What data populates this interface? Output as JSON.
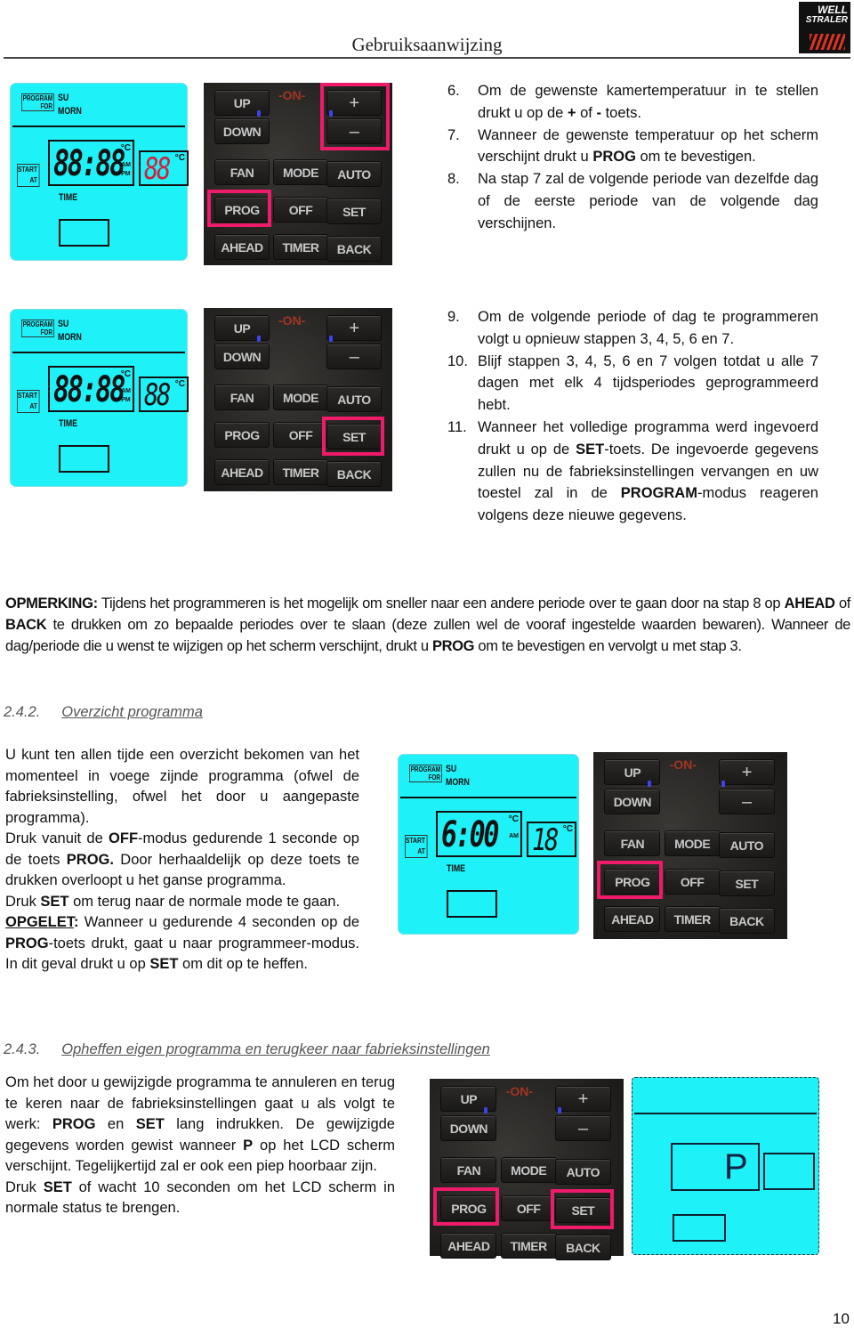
{
  "header": {
    "title": "Gebruiksaanwijzing",
    "logo_line1": "WELL",
    "logo_line2": "STRALER"
  },
  "lcd_labels": {
    "program": "PROGRAM",
    "for": "FOR",
    "day": "SU",
    "period": "MORN",
    "start": "START",
    "at": "AT",
    "time": "TIME",
    "am": "AM",
    "pm": "PM",
    "deg": "°C"
  },
  "remote_keys": {
    "up": "UP",
    "down": "DOWN",
    "on": "-ON-",
    "plus": "+",
    "minus": "–",
    "fan": "FAN",
    "mode": "MODE",
    "auto": "AUTO",
    "prog": "PROG",
    "off": "OFF",
    "set": "SET",
    "ahead": "AHEAD",
    "timer": "TIMER",
    "back": "BACK"
  },
  "figures": {
    "fig1": {
      "time_digits": "88:88",
      "temp_digits": "88",
      "temp_color": "#d0213a",
      "highlighted": [
        "plus-minus",
        "PROG"
      ]
    },
    "fig2": {
      "time_digits": "88:88",
      "temp_digits": "88",
      "temp_color": "#111111",
      "highlighted": [
        "SET"
      ]
    },
    "fig3": {
      "time_digits": "6:00",
      "temp_digits": "18",
      "temp_color": "#111111",
      "show_pm": false,
      "highlighted": [
        "PROG"
      ]
    },
    "fig4": {
      "lcd_symbol": "P",
      "highlighted": [
        "PROG",
        "SET"
      ]
    }
  },
  "steps_a": [
    {
      "num": "6.",
      "html": "Om de gewenste kamertemperatuur in te stellen drukt u op de <b>+</b> of <b>-</b> toets."
    },
    {
      "num": "7.",
      "html": "Wanneer de gewenste temperatuur op het scherm verschijnt drukt u <b>PROG</b> om te bevestigen."
    },
    {
      "num": "8.",
      "html": "Na stap 7 zal de volgende periode van dezelfde dag of de eerste periode van de volgende dag verschijnen."
    }
  ],
  "steps_b": [
    {
      "num": "9.",
      "html": "Om de volgende periode of dag te programmeren volgt u opnieuw stappen 3, 4, 5, 6 en 7."
    },
    {
      "num": "10.",
      "html": "Blijf stappen 3, 4, 5, 6 en 7 volgen totdat u alle 7 dagen met elk 4 tijdsperiodes geprogrammeerd hebt."
    },
    {
      "num": "11.",
      "html": "Wanneer het volledige programma werd ingevoerd drukt u op de <b>SET</b>-toets. De ingevoerde gegevens zullen nu de fabrieksinstellingen vervangen en uw toestel zal in de <b>PROGRAM</b>-modus reageren volgens deze nieuwe gegevens."
    }
  ],
  "note": {
    "label": "OPMERKING:",
    "html": " Tijdens het programmeren is het mogelijk om sneller naar een andere periode over te gaan door na stap 8 op <b>AHEAD</b> of <b>BACK</b> te drukken om zo bepaalde periodes over te slaan (deze zullen wel de vooraf ingestelde waarden bewaren). Wanneer de dag/periode die u wenst te wijzigen op het scherm verschijnt, drukt u <b>PROG</b> om te bevestigen en vervolgt u met stap 3."
  },
  "section_242": {
    "number": "2.4.2.",
    "title": "Overzicht programma",
    "paragraphs": [
      "U kunt ten allen tijde een overzicht bekomen van het momenteel in voege zijnde programma (ofwel de fabrieksinstelling, ofwel het door u aangepaste programma).",
      "Druk vanuit de <b>OFF</b>-modus gedurende 1 seconde op de toets <b>PROG.</b> Door herhaaldelijk op deze toets te drukken overloopt u het ganse programma.",
      "Druk <b>SET</b> om terug naar de normale mode te gaan.",
      "<b><u>OPGELET</u>:</b> Wanneer u gedurende 4 seconden op de <b>PROG</b>-toets drukt, gaat u naar programmeer-modus. In dit geval drukt u op <b>SET</b> om dit op te heffen."
    ]
  },
  "section_243": {
    "number": "2.4.3.",
    "title": "Opheffen eigen programma en terugkeer naar fabrieksinstellingen",
    "paragraphs": [
      "Om het door u gewijzigde programma te annuleren en terug te keren naar de fabrieksinstellingen gaat u als volgt te werk: <b>PROG</b> en <b>SET</b> lang indrukken. De gewijzigde gegevens worden gewist wanneer <b>P</b> op het LCD scherm verschijnt. Tegelijkertijd zal er ook een piep hoorbaar zijn.",
      "Druk <b>SET</b> of wacht 10 seconden om het LCD scherm in normale status te brengen."
    ]
  },
  "page_number": "10"
}
